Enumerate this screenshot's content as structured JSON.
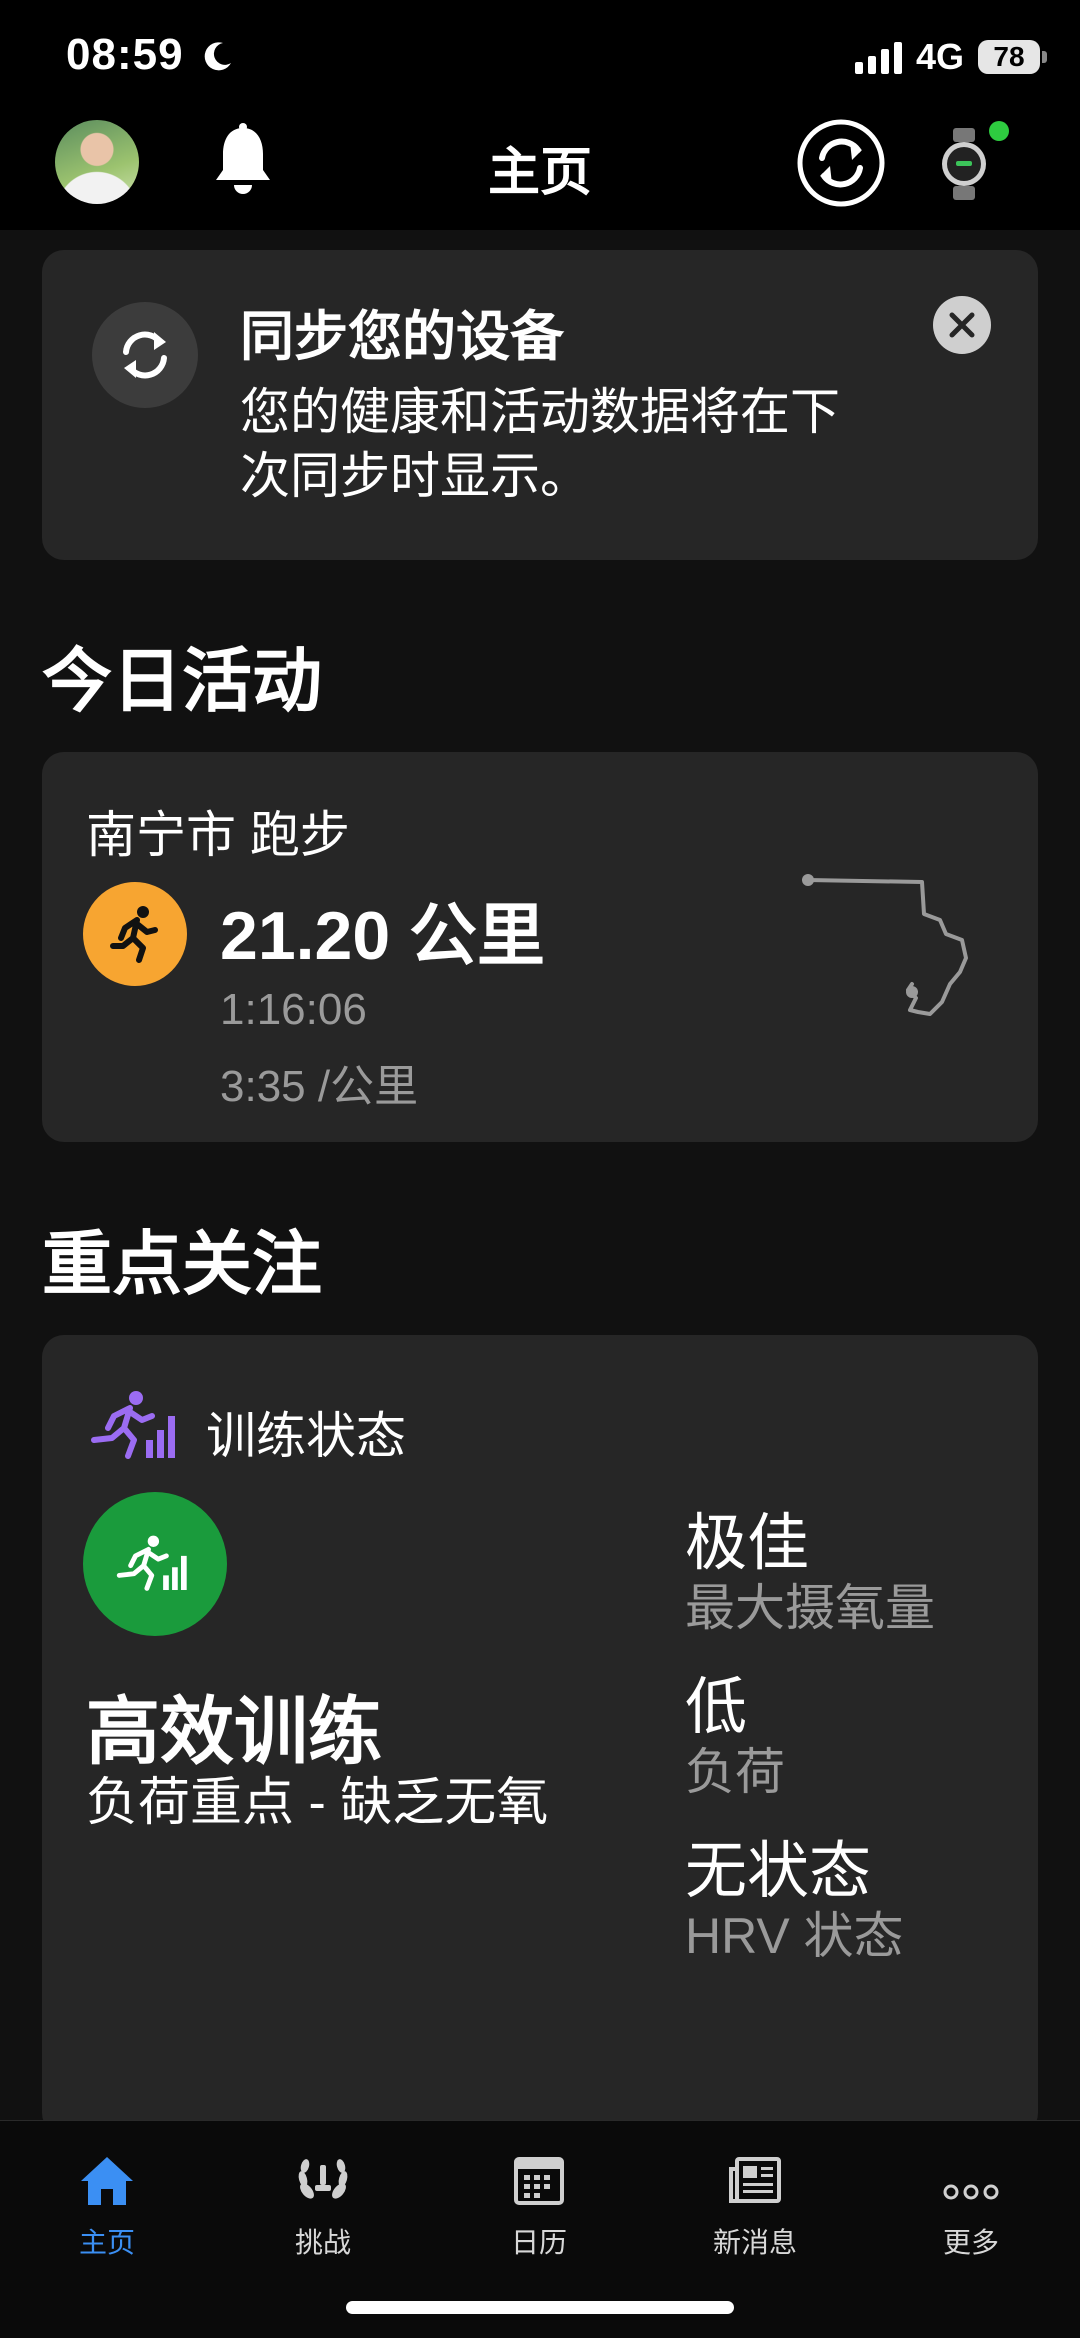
{
  "status_bar": {
    "time": "08:59",
    "network": "4G",
    "battery": "78"
  },
  "header": {
    "title": "主页"
  },
  "sync_banner": {
    "title": "同步您的设备",
    "message": "您的健康和活动数据将在下次同步时显示。"
  },
  "today": {
    "section_title": "今日活动",
    "activity": {
      "name": "南宁市 跑步",
      "distance": "21.20 公里",
      "duration": "1:16:06",
      "pace": "3:35 /公里"
    }
  },
  "focus": {
    "section_title": "重点关注",
    "training_status": {
      "label": "训练状态",
      "status": "高效训练",
      "detail": "负荷重点 - 缺乏无氧",
      "metrics": [
        {
          "value": "极佳",
          "label": "最大摄氧量"
        },
        {
          "value": "低",
          "label": "负荷"
        },
        {
          "value": "无状态",
          "label": "HRV 状态"
        }
      ]
    }
  },
  "bottom_nav": {
    "items": [
      {
        "label": "主页",
        "icon": "home-icon",
        "active": true
      },
      {
        "label": "挑战",
        "icon": "laurel-icon"
      },
      {
        "label": "日历",
        "icon": "calendar-icon"
      },
      {
        "label": "新消息",
        "icon": "news-icon"
      },
      {
        "label": "更多",
        "icon": "more-icon"
      }
    ]
  },
  "colors": {
    "accent": "#3b8ff3",
    "run_orange": "#f7a531",
    "status_green": "#1a9b3c",
    "training_purple": "#9b6cf2",
    "card": "#262626"
  }
}
